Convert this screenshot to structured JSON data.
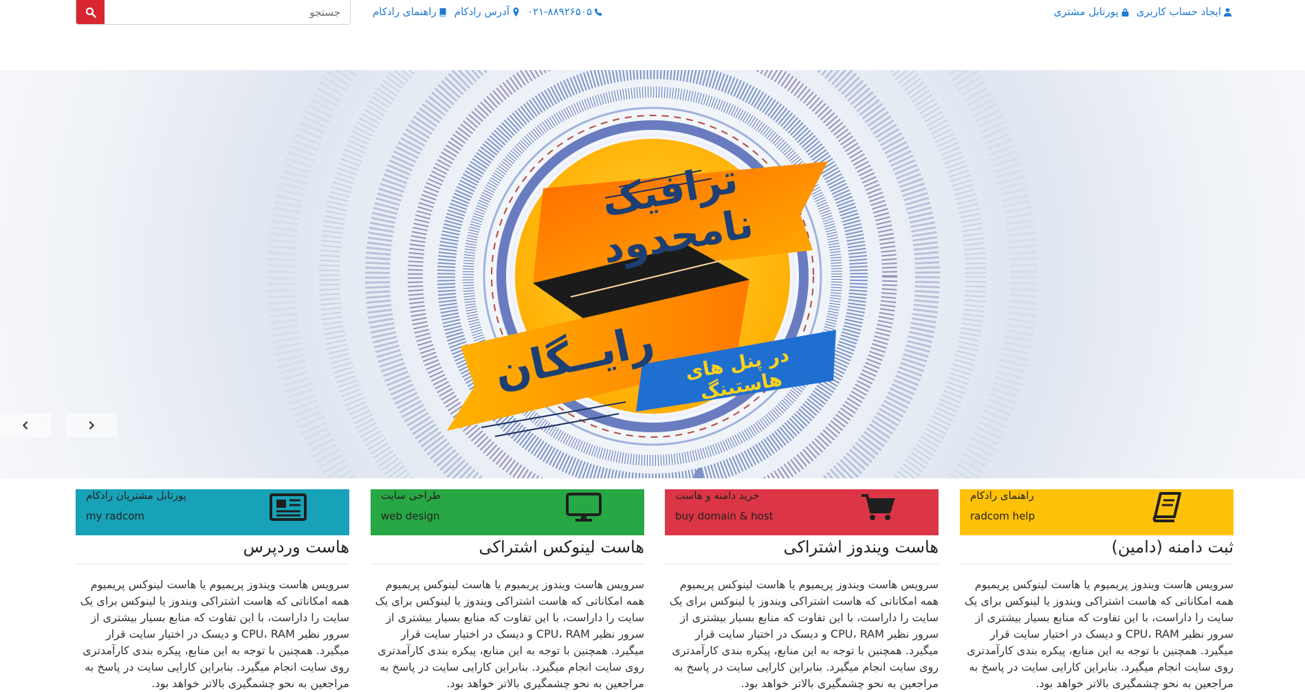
{
  "top_links_right": [
    {
      "label": "پورتابل مشتری",
      "icon": "lock-icon"
    },
    {
      "label": "ایجاد حساب کاربری",
      "icon": "user-icon"
    }
  ],
  "top_links_mid": [
    {
      "label": "راهنمای رادکام",
      "icon": "book-icon"
    },
    {
      "label": "آدرس رادکام",
      "icon": "map-marker-icon"
    },
    {
      "label": "۰۲۱-۸۸۹۲۶۵۰۵",
      "icon": "phone-icon"
    }
  ],
  "search": {
    "placeholder": "جستجو",
    "button_color": "#d7262f"
  },
  "hero": {
    "headline": "ترافیک نامحدود",
    "free": "رایــگان",
    "subline": "در پنل های هاستینگ"
  },
  "tiles": [
    {
      "title": "پورتابل مشتریان رادکام",
      "subtitle": "my radcom",
      "icon": "newspaper-icon",
      "color": "#17a2b8"
    },
    {
      "title": "طراحی سایت",
      "subtitle": "web design",
      "icon": "monitor-icon",
      "color": "#28a745"
    },
    {
      "title": "خرید دامنه و هاست",
      "subtitle": "buy domain & host",
      "icon": "cart-icon",
      "color": "#dc3545"
    },
    {
      "title": "راهنمای رادکام",
      "subtitle": "radcom help",
      "icon": "book-icon",
      "color": "#ffc107"
    }
  ],
  "columns": [
    {
      "title": "هاست وردپرس",
      "body": "سرویس هاست ویندوز پریمیوم یا هاست لینوکس پریمیوم همه امکاناتی که هاست اشتراکی ویندوز یا لینوکس برای یک سایت را داراست، با این تفاوت که منابع بسیار بیشتری از سرور نظیر CPU، RAM و دیسک در اختیار سایت قرار میگیرد. همچنین با توجه به این منابع، پیکره بندی کارآمدتری روی سایت انجام میگیرد. بنابراین کارایی سایت در پاسخ به مراجعین به نحو چشمگیری بالاتر خواهد بود."
    },
    {
      "title": "هاست لینوکس اشتراکی",
      "body": "سرویس هاست ویندوز پریمیوم یا هاست لینوکس پریمیوم همه امکاناتی که هاست اشتراکی ویندوز یا لینوکس برای یک سایت را داراست، با این تفاوت که منابع بسیار بیشتری از سرور نظیر CPU، RAM و دیسک در اختیار سایت قرار میگیرد. همچنین با توجه به این منابع، پیکره بندی کارآمدتری روی سایت انجام میگیرد. بنابراین کارایی سایت در پاسخ به مراجعین به نحو چشمگیری بالاتر خواهد بود."
    },
    {
      "title": "هاست ویندوز اشتراکی",
      "body": "سرویس هاست ویندوز پریمیوم یا هاست لینوکس پریمیوم همه امکاناتی که هاست اشتراکی ویندوز یا لینوکس برای یک سایت را داراست، با این تفاوت که منابع بسیار بیشتری از سرور نظیر CPU، RAM و دیسک در اختیار سایت قرار میگیرد. همچنین با توجه به این منابع، پیکره بندی کارآمدتری روی سایت انجام میگیرد. بنابراین کارایی سایت در پاسخ به مراجعین به نحو چشمگیری بالاتر خواهد بود."
    },
    {
      "title": "ثبت دامنه (دامین)",
      "body": "سرویس هاست ویندوز پریمیوم یا هاست لینوکس پریمیوم همه امکاناتی که هاست اشتراکی ویندوز یا لینوکس برای یک سایت را داراست، با این تفاوت که منابع بسیار بیشتری از سرور نظیر CPU، RAM و دیسک در اختیار سایت قرار میگیرد. همچنین با توجه به این منابع، پیکره بندی کارآمدتری روی سایت انجام میگیرد. بنابراین کارایی سایت در پاسخ به مراجعین به نحو چشمگیری بالاتر خواهد بود."
    }
  ],
  "colors": {
    "link": "#1e7ad6",
    "banner_orange": "#ff8a00",
    "banner_blue": "#1f6fd1",
    "circle_yellow": "#ffc21a"
  }
}
